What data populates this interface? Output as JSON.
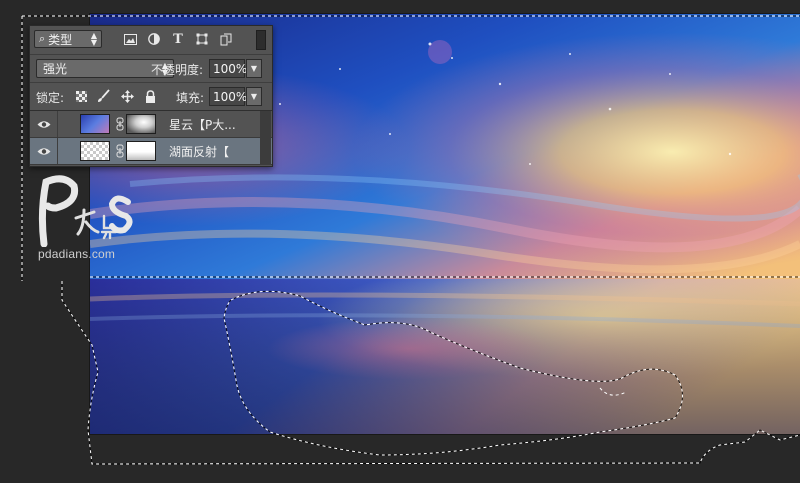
{
  "layers_panel": {
    "filter": {
      "kind_label": "类型",
      "icons": [
        "image-filter-icon",
        "adjustment-filter-icon",
        "type-filter-icon",
        "shape-filter-icon",
        "smart-object-filter-icon"
      ],
      "type_glyph": "T"
    },
    "blend_mode": "强光",
    "opacity_label": "不透明度:",
    "opacity_value": "100%",
    "lock_label": "锁定:",
    "lock_icons": [
      "lock-transparent-pixels-icon",
      "lock-image-pixels-icon",
      "lock-position-icon",
      "lock-all-icon"
    ],
    "fill_label": "填充:",
    "fill_value": "100%",
    "layers": [
      {
        "name": "星云【P大...",
        "visible": true,
        "selected": false
      },
      {
        "name": "湖面反射【",
        "visible": true,
        "selected": true
      }
    ]
  },
  "watermark": {
    "site": "pdadians.com",
    "logo_text": "P大点S"
  },
  "colors": {
    "workspace_bg": "#282828",
    "panel_bg": "#535353",
    "selected_layer_bg": "#6a7580"
  }
}
